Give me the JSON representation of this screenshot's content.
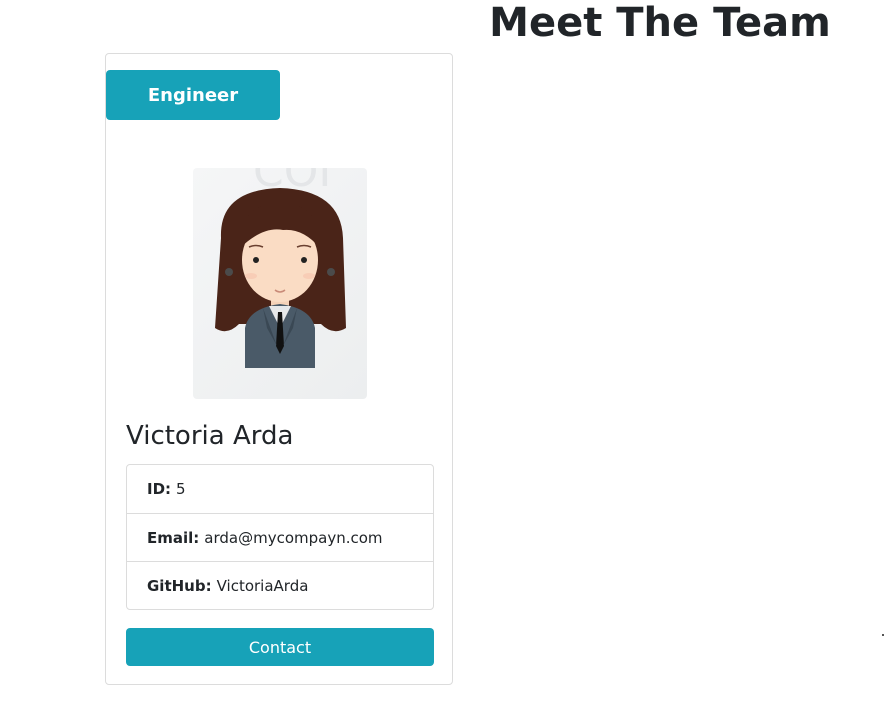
{
  "page": {
    "title": "Meet The Team"
  },
  "member": {
    "role": "Engineer",
    "name": "Victoria Arda",
    "avatar_icon": "female-engineer-avatar-icon",
    "details": [
      {
        "label": "ID:",
        "value": "5"
      },
      {
        "label": "Email:",
        "value": "arda@mycompayn.com"
      },
      {
        "label": "GitHub:",
        "value": "VictoriaArda"
      }
    ],
    "contact_label": "Contact"
  },
  "colors": {
    "accent": "#17a2b8",
    "text": "#212529",
    "border": "#dcdcdc"
  }
}
